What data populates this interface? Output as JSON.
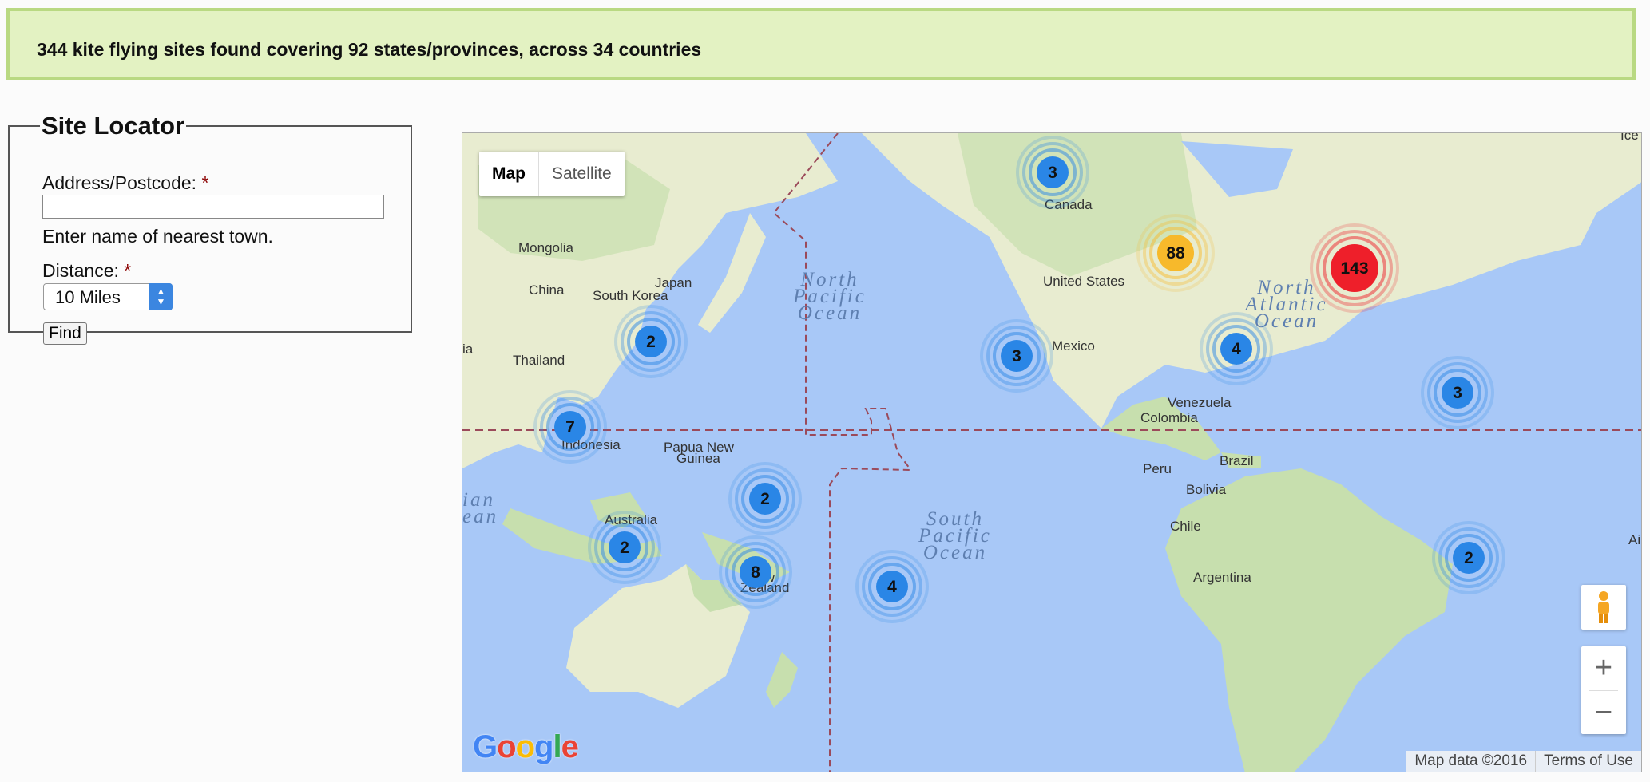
{
  "summary": "344 kite flying sites found covering 92 states/provinces, across 34 countries",
  "locator": {
    "legend": "Site Locator",
    "address_label": "Address/Postcode:",
    "required_mark": "*",
    "address_value": "",
    "address_hint": "Enter name of nearest town.",
    "distance_label": "Distance:",
    "distance_selected": "10 Miles",
    "find_label": "Find"
  },
  "map": {
    "type_map": "Map",
    "type_satellite": "Satellite",
    "attribution": "Map data ©2016",
    "terms": "Terms of Use",
    "logo": "Google",
    "labels": {
      "mongolia": "Mongolia",
      "china": "China",
      "south_korea": "South Korea",
      "japan": "Japan",
      "thailand": "Thailand",
      "indonesia": "Indonesia",
      "png1": "Papua New",
      "png2": "Guinea",
      "australia": "Australia",
      "nz1": "New",
      "nz2": "Zealand",
      "canada": "Canada",
      "usa": "United States",
      "mexico": "Mexico",
      "colombia": "Colombia",
      "venezuela": "Venezuela",
      "brazil": "Brazil",
      "peru": "Peru",
      "bolivia": "Bolivia",
      "chile": "Chile",
      "argentina": "Argentina",
      "ia": "ia",
      "ian": "ian",
      "ean": "ean",
      "ice": "Ice",
      "ai": "Ai"
    },
    "oceans": {
      "npo": [
        "North",
        "Pacific",
        "Ocean"
      ],
      "spo": [
        "South",
        "Pacific",
        "Ocean"
      ],
      "nao": [
        "North",
        "Atlantic",
        "Ocean"
      ]
    },
    "clusters": [
      {
        "id": "alaska",
        "count": "3",
        "level": "blue"
      },
      {
        "id": "west-us",
        "count": "88",
        "level": "yellow"
      },
      {
        "id": "east-us",
        "count": "143",
        "level": "red"
      },
      {
        "id": "taiwan",
        "count": "2",
        "level": "blue"
      },
      {
        "id": "hawaii",
        "count": "3",
        "level": "blue"
      },
      {
        "id": "mexico",
        "count": "4",
        "level": "blue"
      },
      {
        "id": "caribbean",
        "count": "3",
        "level": "blue"
      },
      {
        "id": "indonesia",
        "count": "7",
        "level": "blue"
      },
      {
        "id": "ne-australia",
        "count": "2",
        "level": "blue"
      },
      {
        "id": "w-australia",
        "count": "2",
        "level": "blue"
      },
      {
        "id": "se-australia",
        "count": "8",
        "level": "blue"
      },
      {
        "id": "new-zealand",
        "count": "4",
        "level": "blue"
      },
      {
        "id": "argentina",
        "count": "2",
        "level": "blue"
      }
    ],
    "colors": {
      "water": "#a8c8f7",
      "land": "#e8ecd0",
      "green": "#c7dfae",
      "blue": "#2a86e6",
      "yellow": "#f7b92b",
      "red": "#ee1f2a"
    }
  }
}
